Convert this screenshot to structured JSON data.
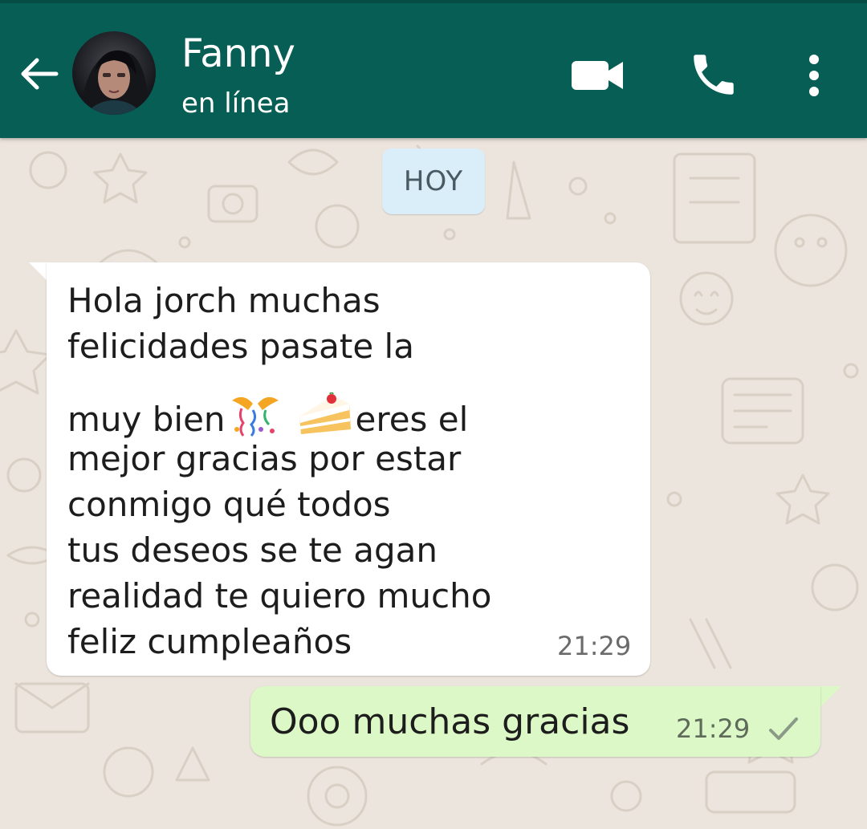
{
  "header": {
    "contact_name": "Fanny",
    "status": "en línea",
    "icons": {
      "back": "arrow-back-icon",
      "video": "video-call-icon",
      "call": "phone-icon",
      "menu": "more-vert-icon"
    },
    "bg_color": "#075e54"
  },
  "date_chip": "HOY",
  "messages": [
    {
      "direction": "incoming",
      "lines": [
        "Hola jorch muchas",
        "felicidades pasate la",
        "muy bien",
        "eres el",
        "mejor gracias por estar",
        "conmigo qué todos",
        "tus deseos se te agan",
        "realidad te quiero mucho",
        "feliz cumpleaños"
      ],
      "emojis": [
        "🎊",
        "🍰"
      ],
      "time": "21:29"
    },
    {
      "direction": "outgoing",
      "text": "Ooo muchas gracias",
      "time": "21:29",
      "status": "single-check-icon"
    }
  ],
  "colors": {
    "chat_bg": "#ece5dd",
    "incoming_bubble": "#ffffff",
    "outgoing_bubble": "#dcf8c6",
    "date_chip_bg": "#d9eef9"
  }
}
